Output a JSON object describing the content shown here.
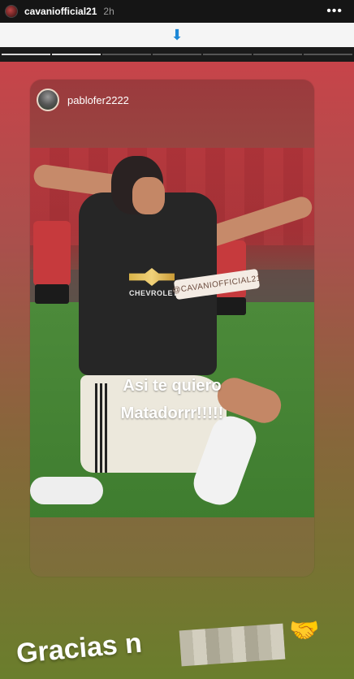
{
  "top_bar": {
    "username": "cavaniofficial21",
    "time": "2h",
    "more": "•••"
  },
  "link_bar": {
    "icon": "download-arrow-icon",
    "arrow_glyph": "⬇"
  },
  "progress": {
    "segments_total": 7,
    "segments_viewed": 2
  },
  "shared_post": {
    "username": "pablofer2222",
    "mention_sticker": "@CAVANIOFFICIAL21",
    "caption_line1": "Asi te quiero",
    "caption_line2": "Matadorrr!!!!!",
    "sponsor": "CHEVROLET"
  },
  "overlay_text": {
    "text": "Gracias n",
    "emoji": "🤝",
    "emoji_icon": "handshake-icon"
  },
  "colors": {
    "gradient_top": "#c7444a",
    "gradient_bottom": "#6a7e2c",
    "link_arrow": "#1e88d6"
  }
}
